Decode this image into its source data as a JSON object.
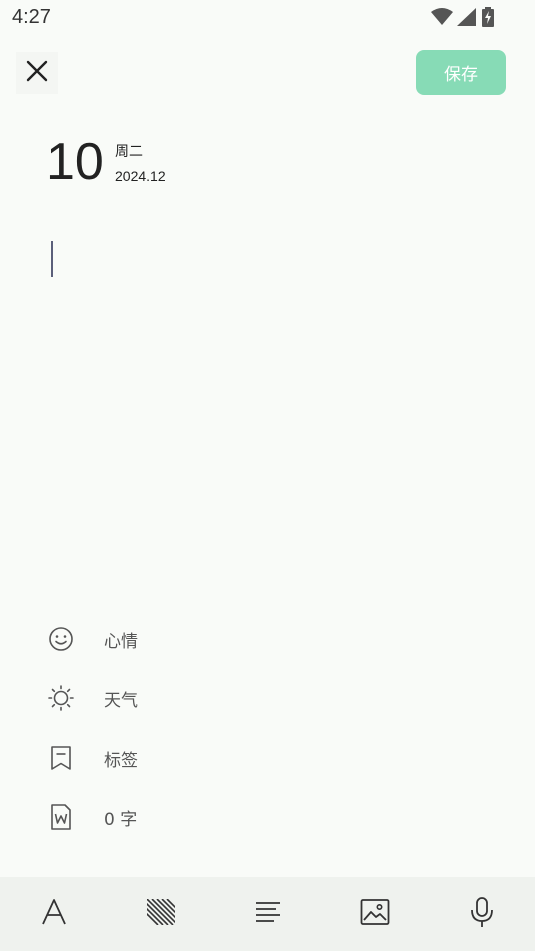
{
  "status_bar": {
    "time": "4:27",
    "icons": [
      "wifi-icon",
      "signal-icon",
      "battery-charging-icon"
    ]
  },
  "header": {
    "close_icon": "close-icon",
    "save_label": "保存",
    "save_color": "#87dbb6"
  },
  "date": {
    "day": "10",
    "weekday": "周二",
    "year_month": "2024.12"
  },
  "editor": {
    "content": ""
  },
  "meta": {
    "items": [
      {
        "icon": "smiley-icon",
        "label": "心情"
      },
      {
        "icon": "sun-icon",
        "label": "天气"
      },
      {
        "icon": "bookmark-icon",
        "label": "标签"
      },
      {
        "icon": "word-document-icon",
        "label": "0 字"
      }
    ]
  },
  "toolbar": {
    "items": [
      "font-icon",
      "texture-icon",
      "align-left-icon",
      "image-icon",
      "microphone-icon"
    ]
  },
  "colors": {
    "background": "#f9fbf8",
    "toolbar_background": "#eff2ee",
    "accent": "#87dbb6"
  }
}
